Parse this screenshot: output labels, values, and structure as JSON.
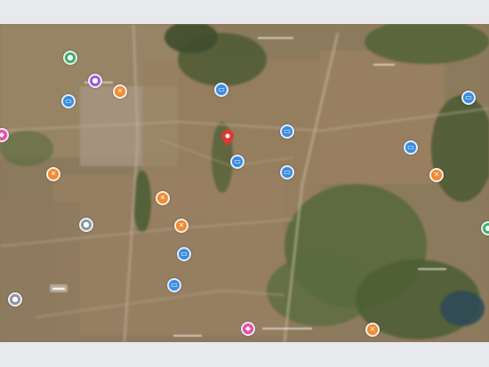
{
  "map": {
    "view": "satellite",
    "blurred": true,
    "selected_marker": {
      "color": "#d93a2f",
      "icon": "location-pin-icon"
    },
    "pins": [
      {
        "id": "pin-green-1",
        "color": "#3fae6a",
        "icon": "place-icon"
      },
      {
        "id": "pin-purple-1",
        "color": "#a259d6",
        "icon": "place-icon"
      },
      {
        "id": "pin-orange-1",
        "color": "#f08a34",
        "icon": "food-icon"
      },
      {
        "id": "pin-blue-1",
        "color": "#3b8be0",
        "icon": "info-icon"
      },
      {
        "id": "pin-blue-2",
        "color": "#3b8be0",
        "icon": "info-icon"
      },
      {
        "id": "pin-blue-3",
        "color": "#3b8be0",
        "icon": "info-icon"
      },
      {
        "id": "pin-blue-4",
        "color": "#3b8be0",
        "icon": "info-icon"
      },
      {
        "id": "pin-blue-5",
        "color": "#3b8be0",
        "icon": "info-icon"
      },
      {
        "id": "pin-blue-6",
        "color": "#3b8be0",
        "icon": "info-icon"
      },
      {
        "id": "pin-blue-7",
        "color": "#3b8be0",
        "icon": "info-icon"
      },
      {
        "id": "pin-blue-8",
        "color": "#3b8be0",
        "icon": "info-icon"
      },
      {
        "id": "pin-blue-9",
        "color": "#3b8be0",
        "icon": "info-icon"
      },
      {
        "id": "pin-orange-2",
        "color": "#f08a34",
        "icon": "food-icon"
      },
      {
        "id": "pin-orange-3",
        "color": "#f08a34",
        "icon": "food-icon"
      },
      {
        "id": "pin-orange-4",
        "color": "#f08a34",
        "icon": "food-icon"
      },
      {
        "id": "pin-orange-5",
        "color": "#f08a34",
        "icon": "food-icon"
      },
      {
        "id": "pin-orange-6",
        "color": "#f08a34",
        "icon": "food-icon"
      },
      {
        "id": "pin-gray-1",
        "color": "#8c95a3",
        "icon": "place-icon"
      },
      {
        "id": "pin-gray-2",
        "color": "#8c95a3",
        "icon": "place-icon"
      },
      {
        "id": "pin-pink-1",
        "color": "#e24fa8",
        "icon": "shopping-icon"
      },
      {
        "id": "pin-pink-2",
        "color": "#e24fa8",
        "icon": "shopping-icon"
      },
      {
        "id": "pin-green-2",
        "color": "#3fae6a",
        "icon": "place-icon"
      }
    ]
  }
}
